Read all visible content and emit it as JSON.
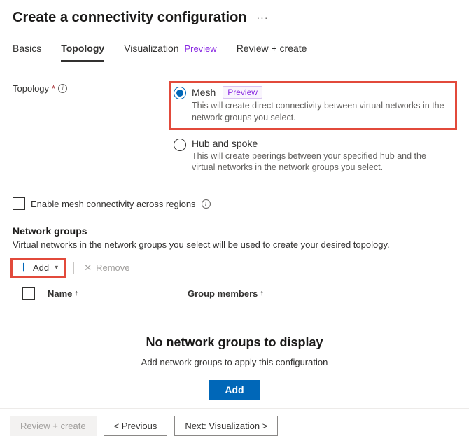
{
  "header": {
    "title": "Create a connectivity configuration"
  },
  "tabs": {
    "basics": "Basics",
    "topology": "Topology",
    "visualization": "Visualization",
    "visualization_badge": "Preview",
    "review": "Review + create"
  },
  "form": {
    "topology_label": "Topology",
    "mesh": {
      "title": "Mesh",
      "badge": "Preview",
      "desc": "This will create direct connectivity between virtual networks in the network groups you select."
    },
    "hubspoke": {
      "title": "Hub and spoke",
      "desc": "This will create peerings between your specified hub and the virtual networks in the network groups you select."
    },
    "enable_mesh_label": "Enable mesh connectivity across regions"
  },
  "network_groups": {
    "heading": "Network groups",
    "desc": "Virtual networks in the network groups you select will be used to create your desired topology.",
    "add_label": "Add",
    "remove_label": "Remove",
    "col_name": "Name",
    "col_members": "Group members",
    "empty_title": "No network groups to display",
    "empty_desc": "Add network groups to apply this configuration",
    "empty_add_btn": "Add"
  },
  "footer": {
    "review": "Review + create",
    "previous": "< Previous",
    "next": "Next: Visualization >"
  }
}
